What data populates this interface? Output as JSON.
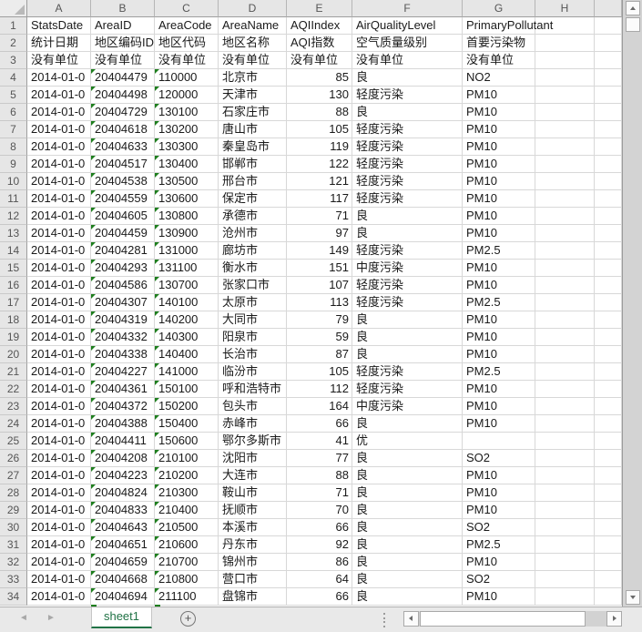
{
  "colors": {
    "sheet_tab_green": "#217346",
    "stored_as_text_triangle": "#1e7e1e",
    "header_background": "#e6e6e6",
    "gridline": "#d8d8d8"
  },
  "column_letters": [
    "A",
    "B",
    "C",
    "D",
    "E",
    "F",
    "G",
    "H"
  ],
  "rows": [
    {
      "n": "1",
      "type": "header",
      "cells": [
        "StatsDate",
        "AreaID",
        "AreaCode",
        "AreaName",
        "AQIIndex",
        "AirQualityLevel",
        "PrimaryPollutant"
      ]
    },
    {
      "n": "2",
      "type": "header",
      "cells": [
        "统计日期",
        "地区编码ID",
        "地区代码",
        "地区名称",
        "AQI指数",
        "空气质量级别",
        "首要污染物"
      ]
    },
    {
      "n": "3",
      "type": "header",
      "cells": [
        "没有单位",
        "没有单位",
        "没有单位",
        "没有单位",
        "没有单位",
        "没有单位",
        "没有单位"
      ]
    },
    {
      "n": "4",
      "type": "data",
      "cells": [
        "2014-01-0",
        "20404479",
        "110000",
        "北京市",
        "85",
        "良",
        "NO2"
      ]
    },
    {
      "n": "5",
      "type": "data",
      "cells": [
        "2014-01-0",
        "20404498",
        "120000",
        "天津市",
        "130",
        "轻度污染",
        "PM10"
      ]
    },
    {
      "n": "6",
      "type": "data",
      "cells": [
        "2014-01-0",
        "20404729",
        "130100",
        "石家庄市",
        "88",
        "良",
        "PM10"
      ]
    },
    {
      "n": "7",
      "type": "data",
      "cells": [
        "2014-01-0",
        "20404618",
        "130200",
        "唐山市",
        "105",
        "轻度污染",
        "PM10"
      ]
    },
    {
      "n": "8",
      "type": "data",
      "cells": [
        "2014-01-0",
        "20404633",
        "130300",
        "秦皇岛市",
        "119",
        "轻度污染",
        "PM10"
      ]
    },
    {
      "n": "9",
      "type": "data",
      "cells": [
        "2014-01-0",
        "20404517",
        "130400",
        "邯郸市",
        "122",
        "轻度污染",
        "PM10"
      ]
    },
    {
      "n": "10",
      "type": "data",
      "cells": [
        "2014-01-0",
        "20404538",
        "130500",
        "邢台市",
        "121",
        "轻度污染",
        "PM10"
      ]
    },
    {
      "n": "11",
      "type": "data",
      "cells": [
        "2014-01-0",
        "20404559",
        "130600",
        "保定市",
        "117",
        "轻度污染",
        "PM10"
      ]
    },
    {
      "n": "12",
      "type": "data",
      "cells": [
        "2014-01-0",
        "20404605",
        "130800",
        "承德市",
        "71",
        "良",
        "PM10"
      ]
    },
    {
      "n": "13",
      "type": "data",
      "cells": [
        "2014-01-0",
        "20404459",
        "130900",
        "沧州市",
        "97",
        "良",
        "PM10"
      ]
    },
    {
      "n": "14",
      "type": "data",
      "cells": [
        "2014-01-0",
        "20404281",
        "131000",
        "廊坊市",
        "149",
        "轻度污染",
        "PM2.5"
      ]
    },
    {
      "n": "15",
      "type": "data",
      "cells": [
        "2014-01-0",
        "20404293",
        "131100",
        "衡水市",
        "151",
        "中度污染",
        "PM10"
      ]
    },
    {
      "n": "16",
      "type": "data",
      "cells": [
        "2014-01-0",
        "20404586",
        "130700",
        "张家口市",
        "107",
        "轻度污染",
        "PM10"
      ]
    },
    {
      "n": "17",
      "type": "data",
      "cells": [
        "2014-01-0",
        "20404307",
        "140100",
        "太原市",
        "113",
        "轻度污染",
        "PM2.5"
      ]
    },
    {
      "n": "18",
      "type": "data",
      "cells": [
        "2014-01-0",
        "20404319",
        "140200",
        "大同市",
        "79",
        "良",
        "PM10"
      ]
    },
    {
      "n": "19",
      "type": "data",
      "cells": [
        "2014-01-0",
        "20404332",
        "140300",
        "阳泉市",
        "59",
        "良",
        "PM10"
      ]
    },
    {
      "n": "20",
      "type": "data",
      "cells": [
        "2014-01-0",
        "20404338",
        "140400",
        "长治市",
        "87",
        "良",
        "PM10"
      ]
    },
    {
      "n": "21",
      "type": "data",
      "cells": [
        "2014-01-0",
        "20404227",
        "141000",
        "临汾市",
        "105",
        "轻度污染",
        "PM2.5"
      ]
    },
    {
      "n": "22",
      "type": "data",
      "cells": [
        "2014-01-0",
        "20404361",
        "150100",
        "呼和浩特市",
        "112",
        "轻度污染",
        "PM10"
      ]
    },
    {
      "n": "23",
      "type": "data",
      "cells": [
        "2014-01-0",
        "20404372",
        "150200",
        "包头市",
        "164",
        "中度污染",
        "PM10"
      ]
    },
    {
      "n": "24",
      "type": "data",
      "cells": [
        "2014-01-0",
        "20404388",
        "150400",
        "赤峰市",
        "66",
        "良",
        "PM10"
      ]
    },
    {
      "n": "25",
      "type": "data",
      "cells": [
        "2014-01-0",
        "20404411",
        "150600",
        "鄂尔多斯市",
        "41",
        "优",
        ""
      ]
    },
    {
      "n": "26",
      "type": "data",
      "cells": [
        "2014-01-0",
        "20404208",
        "210100",
        "沈阳市",
        "77",
        "良",
        "SO2"
      ]
    },
    {
      "n": "27",
      "type": "data",
      "cells": [
        "2014-01-0",
        "20404223",
        "210200",
        "大连市",
        "88",
        "良",
        "PM10"
      ]
    },
    {
      "n": "28",
      "type": "data",
      "cells": [
        "2014-01-0",
        "20404824",
        "210300",
        "鞍山市",
        "71",
        "良",
        "PM10"
      ]
    },
    {
      "n": "29",
      "type": "data",
      "cells": [
        "2014-01-0",
        "20404833",
        "210400",
        "抚顺市",
        "70",
        "良",
        "PM10"
      ]
    },
    {
      "n": "30",
      "type": "data",
      "cells": [
        "2014-01-0",
        "20404643",
        "210500",
        "本溪市",
        "66",
        "良",
        "SO2"
      ]
    },
    {
      "n": "31",
      "type": "data",
      "cells": [
        "2014-01-0",
        "20404651",
        "210600",
        "丹东市",
        "92",
        "良",
        "PM2.5"
      ]
    },
    {
      "n": "32",
      "type": "data",
      "cells": [
        "2014-01-0",
        "20404659",
        "210700",
        "锦州市",
        "86",
        "良",
        "PM10"
      ]
    },
    {
      "n": "33",
      "type": "data",
      "cells": [
        "2014-01-0",
        "20404668",
        "210800",
        "营口市",
        "64",
        "良",
        "SO2"
      ]
    },
    {
      "n": "34",
      "type": "data",
      "cells": [
        "2014-01-0",
        "20404694",
        "211100",
        "盘锦市",
        "66",
        "良",
        "PM10"
      ]
    }
  ],
  "sheet_bar": {
    "active_tab": "sheet1",
    "icons": {
      "nav_prev": "◄",
      "nav_next": "►",
      "add_sheet": "+"
    }
  }
}
